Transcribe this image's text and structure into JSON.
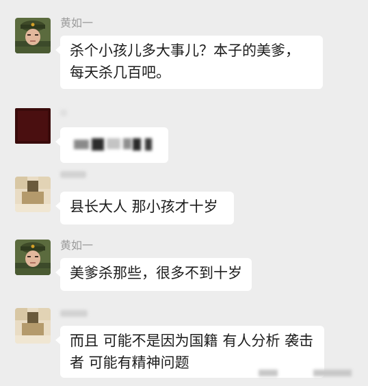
{
  "messages": [
    {
      "sender": "黄如一",
      "text": "杀个小孩儿多大事儿？本子的美爹，每天杀几百吧。"
    },
    {
      "sender": "",
      "text": "",
      "redacted": true
    },
    {
      "sender": "",
      "text": "县长大人 那小孩才十岁"
    },
    {
      "sender": "黄如一",
      "text": "美爹杀那些，很多不到十岁"
    },
    {
      "sender": "",
      "text": "而且 可能不是因为国籍 有人分析 袭击者 可能有精神问题"
    }
  ],
  "colors": {
    "background": "#ededed",
    "bubble": "#ffffff",
    "name": "#9b9b9b",
    "text": "#1c1c1c"
  },
  "icons": [
    "soldier-avatar-icon",
    "dark-red-avatar-icon",
    "pixelated-avatar-icon"
  ]
}
